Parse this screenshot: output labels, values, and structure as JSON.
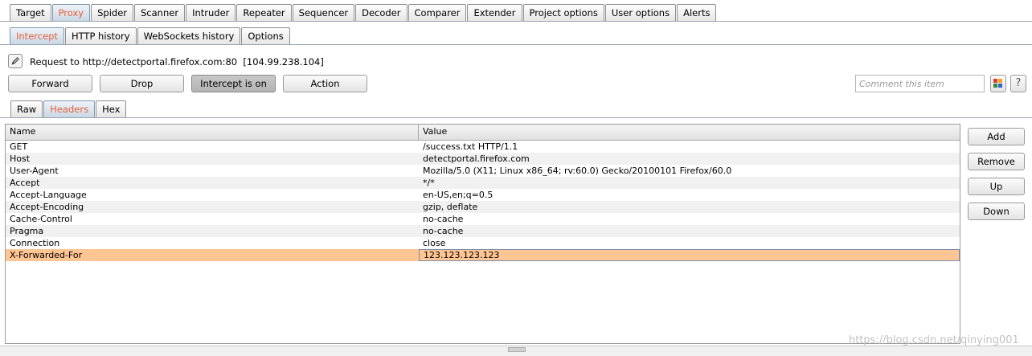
{
  "top_tabs": [
    {
      "label": "Target",
      "active": false
    },
    {
      "label": "Proxy",
      "active": true
    },
    {
      "label": "Spider",
      "active": false
    },
    {
      "label": "Scanner",
      "active": false
    },
    {
      "label": "Intruder",
      "active": false
    },
    {
      "label": "Repeater",
      "active": false
    },
    {
      "label": "Sequencer",
      "active": false
    },
    {
      "label": "Decoder",
      "active": false
    },
    {
      "label": "Comparer",
      "active": false
    },
    {
      "label": "Extender",
      "active": false
    },
    {
      "label": "Project options",
      "active": false
    },
    {
      "label": "User options",
      "active": false
    },
    {
      "label": "Alerts",
      "active": false
    }
  ],
  "proxy_tabs": [
    {
      "label": "Intercept",
      "active": true
    },
    {
      "label": "HTTP history",
      "active": false
    },
    {
      "label": "WebSockets history",
      "active": false
    },
    {
      "label": "Options",
      "active": false
    }
  ],
  "intercept": {
    "request_line": "Request to http://detectportal.firefox.com:80  [104.99.238.104]",
    "buttons": {
      "forward": "Forward",
      "drop": "Drop",
      "intercept_toggle": "Intercept is on",
      "action": "Action"
    },
    "comment_placeholder": "Comment this item",
    "help_label": "?"
  },
  "message_tabs": [
    {
      "label": "Raw",
      "active": false
    },
    {
      "label": "Headers",
      "active": true
    },
    {
      "label": "Hex",
      "active": false
    }
  ],
  "headers_table": {
    "columns": {
      "name": "Name",
      "value": "Value"
    },
    "rows": [
      {
        "name": "GET",
        "value": "/success.txt HTTP/1.1"
      },
      {
        "name": "Host",
        "value": "detectportal.firefox.com"
      },
      {
        "name": "User-Agent",
        "value": "Mozilla/5.0 (X11; Linux x86_64; rv:60.0) Gecko/20100101 Firefox/60.0"
      },
      {
        "name": "Accept",
        "value": "*/*"
      },
      {
        "name": "Accept-Language",
        "value": "en-US,en;q=0.5"
      },
      {
        "name": "Accept-Encoding",
        "value": "gzip, deflate"
      },
      {
        "name": "Cache-Control",
        "value": "no-cache"
      },
      {
        "name": "Pragma",
        "value": "no-cache"
      },
      {
        "name": "Connection",
        "value": "close"
      },
      {
        "name": "X-Forwarded-For",
        "value": "123.123.123.123",
        "selected": true
      }
    ]
  },
  "side_buttons": {
    "add": "Add",
    "remove": "Remove",
    "up": "Up",
    "down": "Down"
  },
  "watermark": "https://blog.csdn.net/qinying001",
  "colors": {
    "active_tab_text": "#e8613a",
    "selected_row": "#ffc593"
  }
}
